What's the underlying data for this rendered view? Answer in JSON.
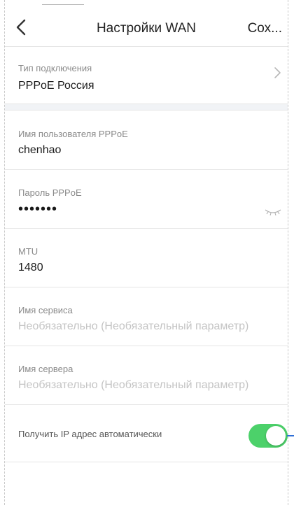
{
  "header": {
    "title": "Настройки WAN",
    "save_label": "Сох..."
  },
  "connection_type": {
    "label": "Тип подключения",
    "value": "PPPoE Россия"
  },
  "username": {
    "label": "Имя пользователя PPPoE",
    "value": "chenhao"
  },
  "password": {
    "label": "Пароль PPPoE",
    "value": "•••••••"
  },
  "mtu": {
    "label": "MTU",
    "value": "1480"
  },
  "service_name": {
    "label": "Имя сервиса",
    "placeholder": "Необязательно (Необязательный параметр)"
  },
  "server_name": {
    "label": "Имя сервера",
    "placeholder": "Необязательно (Необязательный параметр)"
  },
  "auto_ip": {
    "label": "Получить IP адрес автоматически",
    "enabled": true
  },
  "colors": {
    "toggle_on": "#4cd16a",
    "placeholder": "#c4c4c4",
    "label": "#8a8a8a"
  },
  "icons": [
    "back-arrow-icon",
    "chevron-right-icon",
    "eye-closed-icon"
  ]
}
